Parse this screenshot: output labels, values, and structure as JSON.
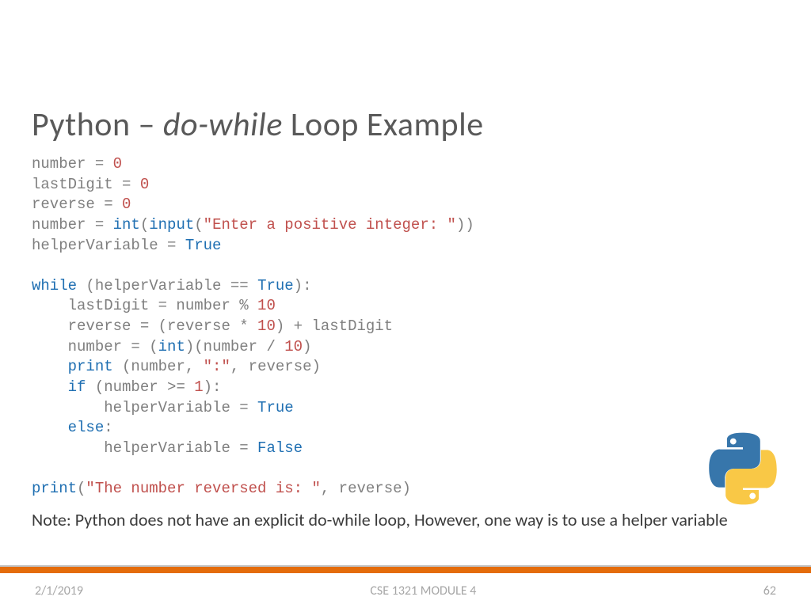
{
  "title": {
    "pre": "Python – ",
    "italic": "do-while",
    "post": " Loop Example"
  },
  "code": {
    "l1a": "number = ",
    "l1b": "0",
    "l2a": "lastDigit = ",
    "l2b": "0",
    "l3a": "reverse = ",
    "l3b": "0",
    "l4a": "number = ",
    "l4b": "int",
    "l4c": "(",
    "l4d": "input",
    "l4e": "(",
    "l4f": "\"Enter a positive integer: \"",
    "l4g": "))",
    "l5a": "helperVariable = ",
    "l5b": "True",
    "blank": "",
    "l7a": "while ",
    "l7b": "(helperVariable == ",
    "l7c": "True",
    "l7d": "):",
    "l8": "    lastDigit = number % ",
    "l8b": "10",
    "l9": "    reverse = (reverse * ",
    "l9b": "10",
    "l9c": ") + lastDigit",
    "l10a": "    number = (",
    "l10b": "int",
    "l10c": ")(number / ",
    "l10d": "10",
    "l10e": ")",
    "l11a": "    ",
    "l11b": "print ",
    "l11c": "(number, ",
    "l11d": "\":\"",
    "l11e": ", reverse)",
    "l12a": "    ",
    "l12b": "if ",
    "l12c": "(number >= ",
    "l12d": "1",
    "l12e": "):",
    "l13a": "        helperVariable = ",
    "l13b": "True",
    "l14a": "    ",
    "l14b": "else",
    "l14c": ":",
    "l15a": "        helperVariable = ",
    "l15b": "False",
    "l17a": "print",
    "l17b": "(",
    "l17c": "\"The number reversed is: \"",
    "l17d": ", reverse)"
  },
  "note": "Note: Python does not have an explicit do-while loop, However, one way is to use a helper variable",
  "footer": {
    "date": "2/1/2019",
    "module": "CSE 1321 MODULE 4",
    "page": "62"
  }
}
